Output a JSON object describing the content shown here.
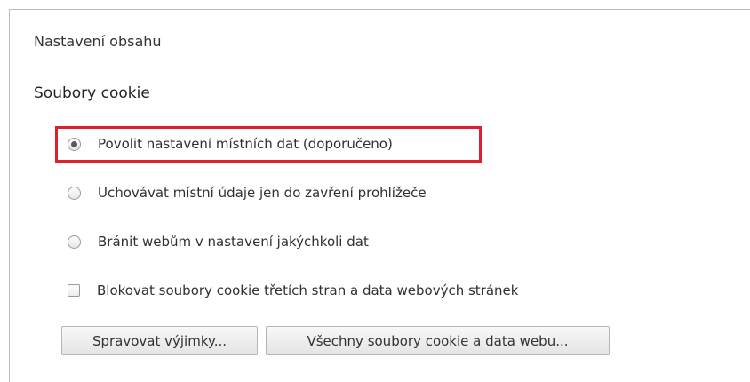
{
  "dialog": {
    "title": "Nastavení obsahu"
  },
  "cookies": {
    "section_title": "Soubory cookie",
    "options": [
      {
        "label": "Povolit nastavení místních dat (doporučeno)",
        "selected": true
      },
      {
        "label": "Uchovávat místní údaje jen do zavření prohlížeče",
        "selected": false
      },
      {
        "label": "Bránit webům v nastavení jakýchkoli dat",
        "selected": false
      }
    ],
    "block_third_party": {
      "label": "Blokovat soubory cookie třetích stran a data webových stránek",
      "checked": false
    },
    "buttons": {
      "exceptions": "Spravovat výjimky...",
      "all_cookies": "Všechny soubory cookie a data webu..."
    }
  },
  "colors": {
    "highlight": "#e0202a"
  }
}
